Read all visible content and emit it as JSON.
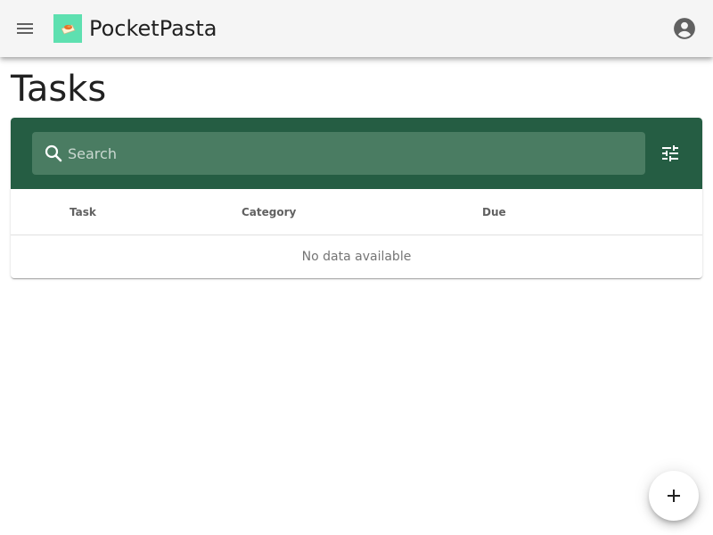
{
  "app": {
    "title": "PocketPasta",
    "logo_icon": "pasta-bowl-icon",
    "menu_icon": "menu-icon",
    "account_icon": "account-circle-icon"
  },
  "page": {
    "title": "Tasks"
  },
  "search": {
    "placeholder": "Search",
    "value": "",
    "icon": "search-icon"
  },
  "toolbar": {
    "filter_icon": "tune-icon"
  },
  "table": {
    "columns": [
      "Task",
      "Category",
      "Due"
    ],
    "rows": [],
    "empty_text": "No data available"
  },
  "fab": {
    "icon": "plus-icon"
  },
  "colors": {
    "app_bar": "#f5f5f5",
    "toolbar": "#255d43",
    "search_field": "#4a7c62",
    "logo_bg": "#5ee0b0",
    "text": "#212121"
  }
}
